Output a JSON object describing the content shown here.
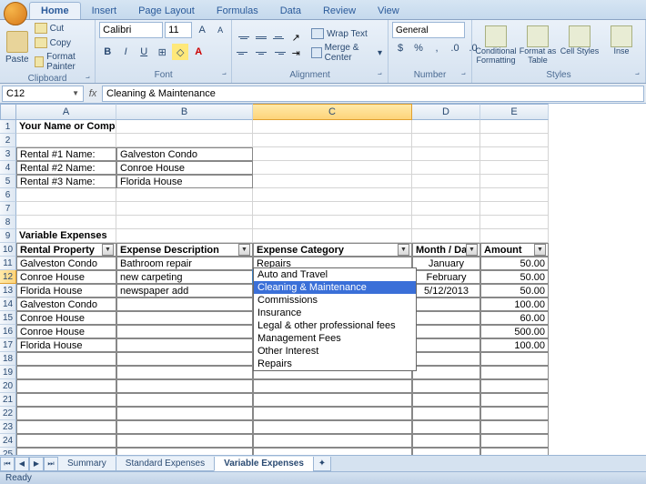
{
  "tabs": [
    "Home",
    "Insert",
    "Page Layout",
    "Formulas",
    "Data",
    "Review",
    "View"
  ],
  "active_tab": "Home",
  "ribbon": {
    "clipboard": {
      "label": "Clipboard",
      "paste": "Paste",
      "cut": "Cut",
      "copy": "Copy",
      "fp": "Format Painter"
    },
    "font": {
      "label": "Font",
      "name": "Calibri",
      "size": "11"
    },
    "alignment": {
      "label": "Alignment",
      "wrap": "Wrap Text",
      "merge": "Merge & Center"
    },
    "number": {
      "label": "Number",
      "format": "General"
    },
    "styles": {
      "label": "Styles",
      "cond": "Conditional Formatting",
      "table": "Format as Table",
      "cell": "Cell Styles",
      "ins": "Inse"
    }
  },
  "name_box": "C12",
  "formula": "Cleaning & Maintenance",
  "columns": [
    "A",
    "B",
    "C",
    "D",
    "E"
  ],
  "active_col": "C",
  "active_row": 12,
  "data": {
    "r1": {
      "A": "Your Name or Company Here"
    },
    "r3": {
      "A": "Rental #1 Name:",
      "B": "Galveston Condo"
    },
    "r4": {
      "A": "Rental #2 Name:",
      "B": "Conroe House"
    },
    "r5": {
      "A": "Rental #3 Name:",
      "B": "Florida House"
    },
    "r9": {
      "A": "Variable Expenses"
    },
    "r10": {
      "A": "Rental Property",
      "B": "Expense Description",
      "C": "Expense Category",
      "D": "Month / Date",
      "E": "Amount"
    },
    "r11": {
      "A": "Galveston Condo",
      "B": "Bathroom repair",
      "C": "Repairs",
      "D": "January",
      "E": "50.00"
    },
    "r12": {
      "A": "Conroe House",
      "B": "new carpeting",
      "C": "Cleaning & Maintenance",
      "D": "February",
      "E": "50.00"
    },
    "r13": {
      "A": "Florida House",
      "B": "newspaper add",
      "C": "",
      "D": "5/12/2013",
      "E": "50.00"
    },
    "r14": {
      "A": "Galveston Condo",
      "B": "",
      "C": "",
      "D": "",
      "E": "100.00"
    },
    "r15": {
      "A": "Conroe House",
      "B": "",
      "C": "",
      "D": "",
      "E": "60.00"
    },
    "r16": {
      "A": "Conroe House",
      "B": "",
      "C": "",
      "D": "",
      "E": "500.00"
    },
    "r17": {
      "A": "Florida House",
      "B": "",
      "C": "",
      "D": "",
      "E": "100.00"
    }
  },
  "dropdown": {
    "items": [
      "Auto and Travel",
      "Cleaning & Maintenance",
      "Commissions",
      "Insurance",
      "Legal & other professional fees",
      "Management Fees",
      "Other Interest",
      "Repairs"
    ],
    "highlight": "Cleaning & Maintenance"
  },
  "sheets": [
    "Summary",
    "Standard Expenses",
    "Variable Expenses"
  ],
  "active_sheet": "Variable Expenses",
  "status": "Ready"
}
